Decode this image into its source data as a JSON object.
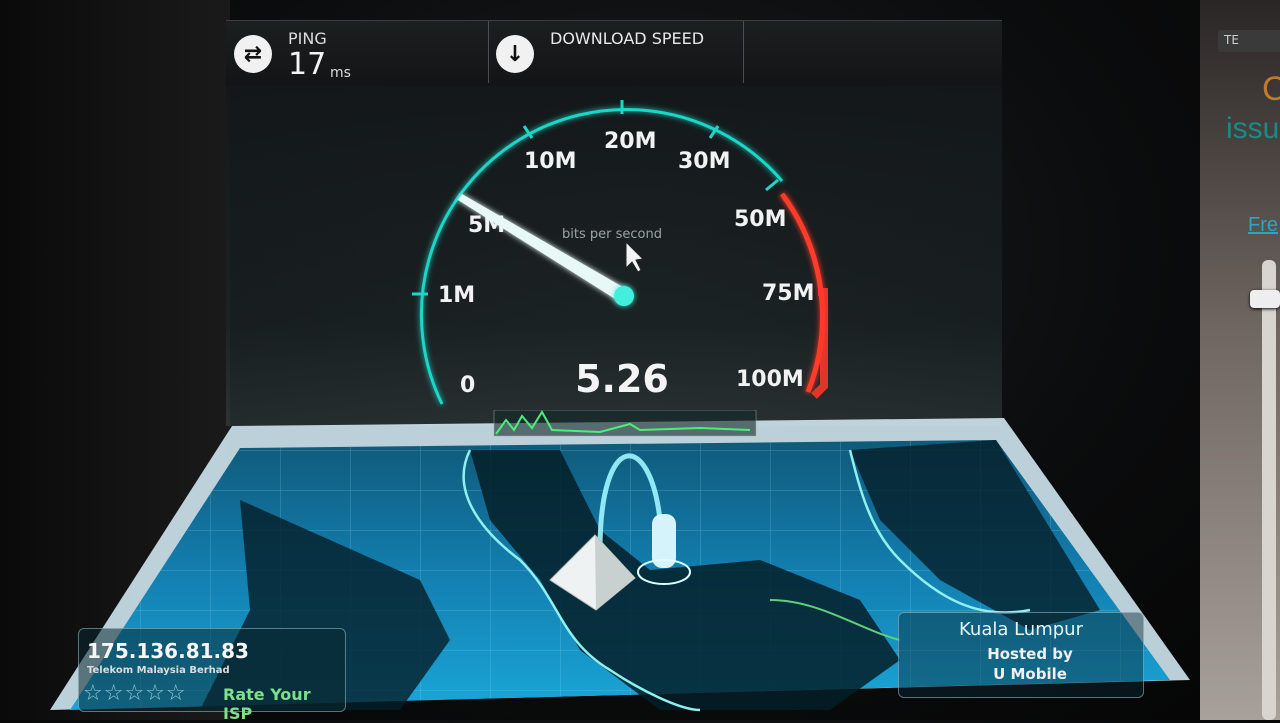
{
  "header": {
    "ping_label": "PING",
    "ping_value": "17",
    "ping_unit": "ms",
    "download_label": "DOWNLOAD SPEED"
  },
  "gauge": {
    "scale_labels": [
      "0",
      "1M",
      "5M",
      "10M",
      "20M",
      "30M",
      "50M",
      "75M",
      "100M"
    ],
    "unit_caption": "bits per second",
    "current_value": "5.26",
    "current_mbps": 5.26
  },
  "server": {
    "city": "Kuala Lumpur",
    "hosted_by_label": "Hosted by",
    "host_isp": "U Mobile"
  },
  "client": {
    "ip": "175.136.81.83",
    "isp": "Telekom Malaysia Berhad",
    "rating_stars": "☆☆☆☆☆",
    "rate_link": "Rate Your ISP"
  },
  "side_panel": {
    "tab": "TE",
    "letter": "C",
    "word": "issu",
    "link": "Fre"
  },
  "colors": {
    "accent": "#1fd6c8",
    "danger": "#ff3a2a",
    "platform": "#1aa6d8"
  },
  "icons": [
    "ping-icon",
    "download-icon"
  ]
}
